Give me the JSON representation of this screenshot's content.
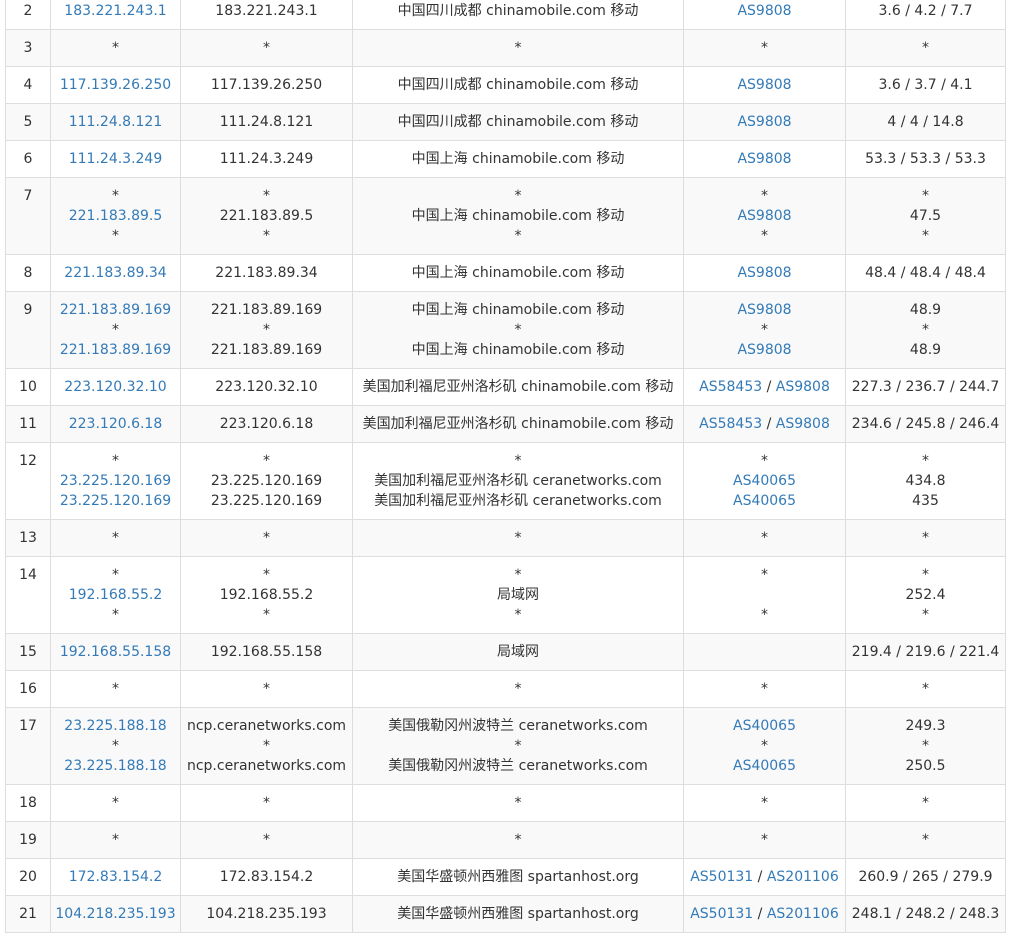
{
  "hops": [
    {
      "idx": "2",
      "ip": [
        "183.221.243.1"
      ],
      "host": [
        "183.221.243.1"
      ],
      "loc": [
        "中国四川成都 chinamobile.com 移动"
      ],
      "asn": [
        [
          "AS9808"
        ]
      ],
      "lat": [
        "3.6 / 4.2 / 7.7"
      ]
    },
    {
      "idx": "3",
      "ip": [
        "*"
      ],
      "host": [
        "*"
      ],
      "loc": [
        "*"
      ],
      "asn": [
        [
          "*"
        ]
      ],
      "lat": [
        "*"
      ]
    },
    {
      "idx": "4",
      "ip": [
        "117.139.26.250"
      ],
      "host": [
        "117.139.26.250"
      ],
      "loc": [
        "中国四川成都 chinamobile.com 移动"
      ],
      "asn": [
        [
          "AS9808"
        ]
      ],
      "lat": [
        "3.6 / 3.7 / 4.1"
      ]
    },
    {
      "idx": "5",
      "ip": [
        "111.24.8.121"
      ],
      "host": [
        "111.24.8.121"
      ],
      "loc": [
        "中国四川成都 chinamobile.com 移动"
      ],
      "asn": [
        [
          "AS9808"
        ]
      ],
      "lat": [
        "4 / 4 / 14.8"
      ]
    },
    {
      "idx": "6",
      "ip": [
        "111.24.3.249"
      ],
      "host": [
        "111.24.3.249"
      ],
      "loc": [
        "中国上海 chinamobile.com 移动"
      ],
      "asn": [
        [
          "AS9808"
        ]
      ],
      "lat": [
        "53.3 / 53.3 / 53.3"
      ]
    },
    {
      "idx": "7",
      "ip": [
        "*",
        "221.183.89.5",
        "*"
      ],
      "host": [
        "*",
        "221.183.89.5",
        "*"
      ],
      "loc": [
        "*",
        "中国上海 chinamobile.com 移动",
        "*"
      ],
      "asn": [
        [
          "*"
        ],
        [
          "AS9808"
        ],
        [
          "*"
        ]
      ],
      "lat": [
        "*",
        "47.5",
        "*"
      ]
    },
    {
      "idx": "8",
      "ip": [
        "221.183.89.34"
      ],
      "host": [
        "221.183.89.34"
      ],
      "loc": [
        "中国上海 chinamobile.com 移动"
      ],
      "asn": [
        [
          "AS9808"
        ]
      ],
      "lat": [
        "48.4 / 48.4 / 48.4"
      ]
    },
    {
      "idx": "9",
      "ip": [
        "221.183.89.169",
        "*",
        "221.183.89.169"
      ],
      "host": [
        "221.183.89.169",
        "*",
        "221.183.89.169"
      ],
      "loc": [
        "中国上海 chinamobile.com 移动",
        "*",
        "中国上海 chinamobile.com 移动"
      ],
      "asn": [
        [
          "AS9808"
        ],
        [
          "*"
        ],
        [
          "AS9808"
        ]
      ],
      "lat": [
        "48.9",
        "*",
        "48.9"
      ]
    },
    {
      "idx": "10",
      "ip": [
        "223.120.32.10"
      ],
      "host": [
        "223.120.32.10"
      ],
      "loc": [
        "美国加利福尼亚州洛杉矶 chinamobile.com 移动"
      ],
      "asn": [
        [
          "AS58453",
          "AS9808"
        ]
      ],
      "lat": [
        "227.3 / 236.7 / 244.7"
      ]
    },
    {
      "idx": "11",
      "ip": [
        "223.120.6.18"
      ],
      "host": [
        "223.120.6.18"
      ],
      "loc": [
        "美国加利福尼亚州洛杉矶 chinamobile.com 移动"
      ],
      "asn": [
        [
          "AS58453",
          "AS9808"
        ]
      ],
      "lat": [
        "234.6 / 245.8 / 246.4"
      ]
    },
    {
      "idx": "12",
      "ip": [
        "*",
        "23.225.120.169",
        "23.225.120.169"
      ],
      "host": [
        "*",
        "23.225.120.169",
        "23.225.120.169"
      ],
      "loc": [
        "*",
        "美国加利福尼亚州洛杉矶 ceranetworks.com",
        "美国加利福尼亚州洛杉矶 ceranetworks.com"
      ],
      "asn": [
        [
          "*"
        ],
        [
          "AS40065"
        ],
        [
          "AS40065"
        ]
      ],
      "lat": [
        "*",
        "434.8",
        "435"
      ]
    },
    {
      "idx": "13",
      "ip": [
        "*"
      ],
      "host": [
        "*"
      ],
      "loc": [
        "*"
      ],
      "asn": [
        [
          "*"
        ]
      ],
      "lat": [
        "*"
      ]
    },
    {
      "idx": "14",
      "ip": [
        "*",
        "192.168.55.2",
        "*"
      ],
      "host": [
        "*",
        "192.168.55.2",
        "*"
      ],
      "loc": [
        "*",
        "局域网",
        "*"
      ],
      "asn": [
        [
          "*"
        ],
        [],
        [
          "*"
        ]
      ],
      "lat": [
        "*",
        "252.4",
        "*"
      ]
    },
    {
      "idx": "15",
      "ip": [
        "192.168.55.158"
      ],
      "host": [
        "192.168.55.158"
      ],
      "loc": [
        "局域网"
      ],
      "asn": [
        []
      ],
      "lat": [
        "219.4 / 219.6 / 221.4"
      ]
    },
    {
      "idx": "16",
      "ip": [
        "*"
      ],
      "host": [
        "*"
      ],
      "loc": [
        "*"
      ],
      "asn": [
        [
          "*"
        ]
      ],
      "lat": [
        "*"
      ]
    },
    {
      "idx": "17",
      "ip": [
        "23.225.188.18",
        "*",
        "23.225.188.18"
      ],
      "host": [
        "ncp.ceranetworks.com",
        "*",
        "ncp.ceranetworks.com"
      ],
      "loc": [
        "美国俄勒冈州波特兰 ceranetworks.com",
        "*",
        "美国俄勒冈州波特兰 ceranetworks.com"
      ],
      "asn": [
        [
          "AS40065"
        ],
        [
          "*"
        ],
        [
          "AS40065"
        ]
      ],
      "lat": [
        "249.3",
        "*",
        "250.5"
      ]
    },
    {
      "idx": "18",
      "ip": [
        "*"
      ],
      "host": [
        "*"
      ],
      "loc": [
        "*"
      ],
      "asn": [
        [
          "*"
        ]
      ],
      "lat": [
        "*"
      ]
    },
    {
      "idx": "19",
      "ip": [
        "*"
      ],
      "host": [
        "*"
      ],
      "loc": [
        "*"
      ],
      "asn": [
        [
          "*"
        ]
      ],
      "lat": [
        "*"
      ]
    },
    {
      "idx": "20",
      "ip": [
        "172.83.154.2"
      ],
      "host": [
        "172.83.154.2"
      ],
      "loc": [
        "美国华盛顿州西雅图 spartanhost.org"
      ],
      "asn": [
        [
          "AS50131",
          "AS201106"
        ]
      ],
      "lat": [
        "260.9 / 265 / 279.9"
      ]
    },
    {
      "idx": "21",
      "ip": [
        "104.218.235.193"
      ],
      "host": [
        "104.218.235.193"
      ],
      "loc": [
        "美国华盛顿州西雅图 spartanhost.org"
      ],
      "asn": [
        [
          "AS50131",
          "AS201106"
        ]
      ],
      "lat": [
        "248.1 / 248.2 / 248.3"
      ]
    }
  ],
  "colors": {
    "link": "#337ab7",
    "border": "#dddddd",
    "stripe": "#f9f9f9",
    "text": "#333333"
  }
}
